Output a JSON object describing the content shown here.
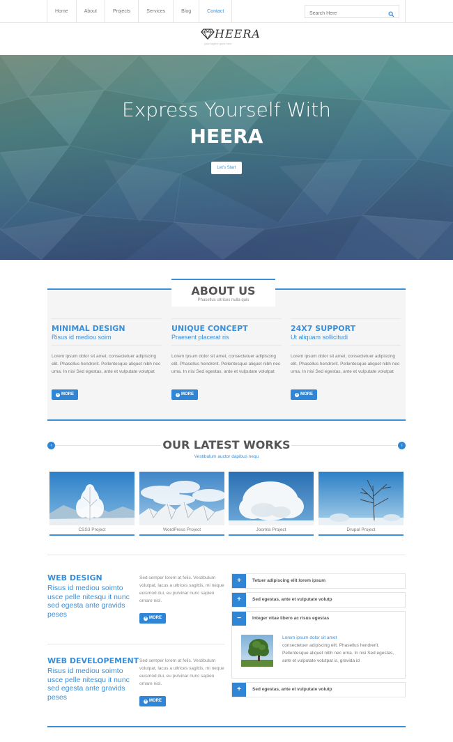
{
  "nav": {
    "items": [
      {
        "label": "Home",
        "active": false
      },
      {
        "label": "About",
        "active": false
      },
      {
        "label": "Projects",
        "active": false
      },
      {
        "label": "Services",
        "active": false
      },
      {
        "label": "Blog",
        "active": false
      },
      {
        "label": "Contact",
        "active": true
      }
    ],
    "search_placeholder": "Search Here",
    "search_icon": "search-icon"
  },
  "logo": {
    "text": "HEERA",
    "tagline": "your tagline goes here",
    "icon": "diamond-icon"
  },
  "hero": {
    "line1": "Express Yourself With",
    "line2": "HEERA",
    "button": "Let's Start"
  },
  "about": {
    "title": "ABOUT US",
    "subtitle": "Phasellus ultrices nulla quis",
    "features": [
      {
        "title": "MINIMAL DESIGN",
        "subtitle": "Risus id mediou soim",
        "body": "Lorem ipsum dolor sit amet, consectetuer adipiscing elit. Phasellus hendrerit. Pellentesque aliquet nibh nec urna. In nisi Sed egestas, ante et vulputate volutpat",
        "button": "MORE"
      },
      {
        "title": "UNIQUE CONCEPT",
        "subtitle": "Praesent placerat ris",
        "body": "Lorem ipsum dolor sit amet, consectetuer adipiscing elit. Phasellus hendrerit. Pellentesque aliquet nibh nec urna. In nisi Sed egestas, ante et vulputate volutpat",
        "button": "MORE"
      },
      {
        "title": "24X7 SUPPORT",
        "subtitle": "Ut aliquam sollicitudi",
        "body": "Lorem ipsum dolor sit amet, consectetuer adipiscing elit. Phasellus hendrerit. Pellentesque aliquet nibh nec urna. In nisi Sed egestas, ante et vulputate volutpat",
        "button": "MORE"
      }
    ]
  },
  "works": {
    "title": "OUR LATEST WORKS",
    "subtitle": "Vestibulum auctor dapibus nequ",
    "prev_icon": "chevron-left-icon",
    "next_icon": "chevron-right-icon",
    "items": [
      {
        "label": "CSS3 Project"
      },
      {
        "label": "WordPress Project"
      },
      {
        "label": "Joomla Project"
      },
      {
        "label": "Drupal Project"
      }
    ]
  },
  "services": [
    {
      "title": "WEB DESIGN",
      "subtitle": "Risus id mediou soimto usce pelle nitesqu it nunc sed egesta ante gravids peses",
      "body": "Sed semper lorem at felis. Vestibulum volutpat, lacus a ultrices sagittis, mi neque euismod dui, eu pulvinar nunc sapien ornare nisl.",
      "button": "MORE"
    },
    {
      "title": "WEB DEVELOPEMENT",
      "subtitle": "Risus id mediou soimto usce pelle nitesqu it nunc sed egesta ante gravids peses",
      "body": "Sed semper lorem at felis. Vestibulum volutpat, lacus a ultrices sagittis, mi neque euismod dui, eu pulvinar nunc sapien ornare nisl.",
      "button": "MORE"
    }
  ],
  "accordion": {
    "items": [
      {
        "label": "Tetuer adipiscing elit lorem ipsum",
        "toggle": "+",
        "expanded": false
      },
      {
        "label": "Sed egestas, ante et vulputate volutp",
        "toggle": "+",
        "expanded": false
      },
      {
        "label": "Integer vitae libero ac risus egestas",
        "toggle": "−",
        "expanded": true
      },
      {
        "label": "Sed egestas, ante et vulputate volutp",
        "toggle": "+",
        "expanded": false
      }
    ],
    "panel_title": "Lorem ipsum dolor sit amet",
    "panel_text": "consectetuer adipiscing elit. Phasellus hendrerit. Pellentesque aliquet nibh nec urna. In nisi Sed egestas, ante et vulputate volutpat is, gravida id"
  },
  "colors": {
    "accent": "#3a8fd9",
    "button": "#2f86d6",
    "heading": "#555555"
  }
}
